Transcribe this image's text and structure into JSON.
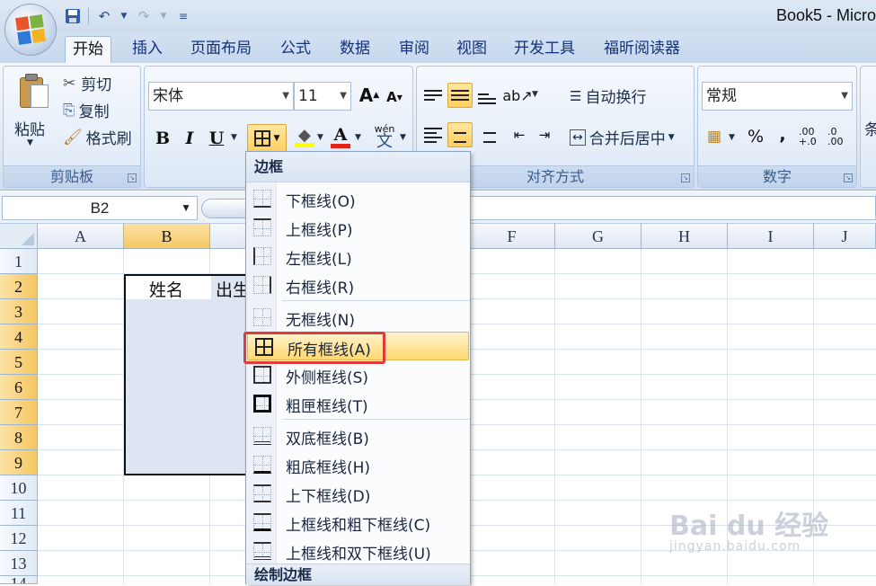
{
  "app": {
    "title": "Book5 - Micro",
    "quick_access": {
      "save_icon": "save-icon",
      "undo_icon": "undo-icon",
      "redo_icon": "redo-icon",
      "customize_icon": "customize-qat-icon"
    }
  },
  "tabs": [
    {
      "label": "开始",
      "active": true
    },
    {
      "label": "插入"
    },
    {
      "label": "页面布局"
    },
    {
      "label": "公式"
    },
    {
      "label": "数据"
    },
    {
      "label": "审阅"
    },
    {
      "label": "视图"
    },
    {
      "label": "开发工具"
    },
    {
      "label": "福昕阅读器"
    }
  ],
  "ribbon": {
    "clipboard": {
      "paste_label": "粘贴",
      "cut_label": "剪切",
      "copy_label": "复制",
      "format_painter_label": "格式刷",
      "group_label": "剪贴板"
    },
    "font": {
      "font_name": "宋体",
      "font_size": "11",
      "bold": "B",
      "italic": "I",
      "underline": "U",
      "font_color_glyph": "A",
      "phonetic_glyph": "wén",
      "phonetic_char": "文"
    },
    "alignment": {
      "wrap_text_label": "自动换行",
      "merge_center_label": "合并后居中",
      "group_label": "对齐方式"
    },
    "number": {
      "format_value": "常规",
      "percent": "%",
      "comma": ",",
      "inc_decimal": ".00 +.0",
      "dec_decimal": ".0 .00",
      "group_label": "数字"
    },
    "styles": {
      "partial_label": "条"
    }
  },
  "formula_bar": {
    "name_box": "B2"
  },
  "grid": {
    "columns": [
      "A",
      "B",
      "C",
      "D",
      "E",
      "F",
      "G",
      "H",
      "I",
      "J"
    ],
    "rows": [
      "1",
      "2",
      "3",
      "4",
      "5",
      "6",
      "7",
      "8",
      "9",
      "10",
      "11",
      "12",
      "13",
      "14"
    ],
    "selected_column": "B",
    "selected_rows": [
      "2",
      "3",
      "4",
      "5",
      "6",
      "7",
      "8",
      "9"
    ],
    "cells": {
      "B2": "姓名",
      "C2": "出生"
    }
  },
  "border_menu": {
    "header": "边框",
    "items": [
      {
        "label": "下框线(O)",
        "icon": "bottom-border-icon"
      },
      {
        "label": "上框线(P)",
        "icon": "top-border-icon"
      },
      {
        "label": "左框线(L)",
        "icon": "left-border-icon"
      },
      {
        "label": "右框线(R)",
        "icon": "right-border-icon"
      },
      {
        "label": "无框线(N)",
        "icon": "no-border-icon"
      },
      {
        "label": "所有框线(A)",
        "icon": "all-borders-icon",
        "highlighted": true
      },
      {
        "label": "外侧框线(S)",
        "icon": "outside-borders-icon"
      },
      {
        "label": "粗匣框线(T)",
        "icon": "thick-box-border-icon"
      },
      {
        "label": "双底框线(B)",
        "icon": "double-bottom-border-icon"
      },
      {
        "label": "粗底框线(H)",
        "icon": "thick-bottom-border-icon"
      },
      {
        "label": "上下框线(D)",
        "icon": "top-bottom-border-icon"
      },
      {
        "label": "上框线和粗下框线(C)",
        "icon": "top-thick-bottom-border-icon"
      },
      {
        "label": "上框线和双下框线(U)",
        "icon": "top-double-bottom-border-icon"
      }
    ],
    "footer": "绘制边框"
  },
  "watermark": {
    "brand": "Bai du 经验",
    "url": "jingyan.baidu.com"
  },
  "colors": {
    "highlight": "#ffd86f",
    "selected_header": "#f5c662",
    "annotation_red": "#e03b3b",
    "ribbon_blue": "#dde8f5"
  }
}
